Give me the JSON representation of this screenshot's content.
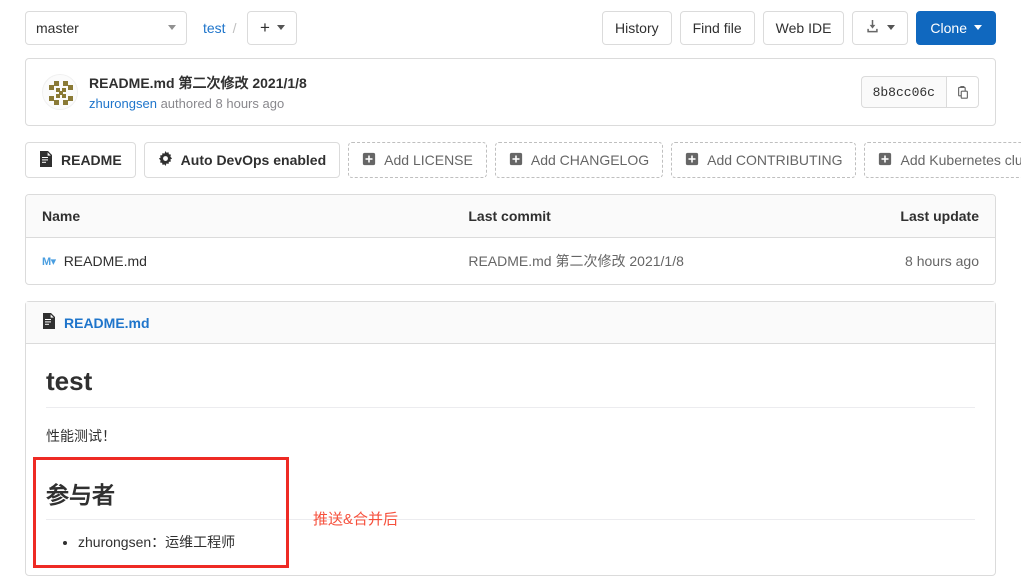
{
  "topbar": {
    "branch": "master",
    "breadcrumb_project": "test",
    "breadcrumb_separator": "/",
    "add_glyph": "+",
    "buttons": {
      "history": "History",
      "find_file": "Find file",
      "web_ide": "Web IDE",
      "download_icon": "download-icon",
      "clone": "Clone"
    }
  },
  "commit": {
    "title": "README.md 第二次修改 2021/1/8",
    "author": "zhurongsen",
    "meta": "authored 8 hours ago",
    "sha": "8b8cc06c",
    "copy_icon": "clipboard-icon",
    "avatar_icon": "identicon-avatar"
  },
  "quick_actions": [
    {
      "label": "README",
      "icon": "document-icon",
      "dashed": false
    },
    {
      "label": "Auto DevOps enabled",
      "icon": "gear-icon",
      "dashed": false
    },
    {
      "label": "Add LICENSE",
      "icon": "plus-square-icon",
      "dashed": true
    },
    {
      "label": "Add CHANGELOG",
      "icon": "plus-square-icon",
      "dashed": true
    },
    {
      "label": "Add CONTRIBUTING",
      "icon": "plus-square-icon",
      "dashed": true
    },
    {
      "label": "Add Kubernetes cluster",
      "icon": "plus-square-icon",
      "dashed": true
    }
  ],
  "file_table": {
    "columns": [
      "Name",
      "Last commit",
      "Last update"
    ],
    "rows": [
      {
        "name": "README.md",
        "icon": "markdown-file-icon",
        "last_commit": "README.md 第二次修改 2021/1/8",
        "last_update": "8 hours ago"
      }
    ]
  },
  "readme": {
    "header_icon": "document-icon",
    "header_title": "README.md",
    "h1": "test",
    "paragraph": "性能测试！",
    "h2": "参与者",
    "list": [
      "zhurongsen：运维工程师"
    ]
  },
  "annotations": {
    "note_text": "推送&合并后",
    "box_color": "#ee2a24",
    "text_color": "#f6503c"
  }
}
